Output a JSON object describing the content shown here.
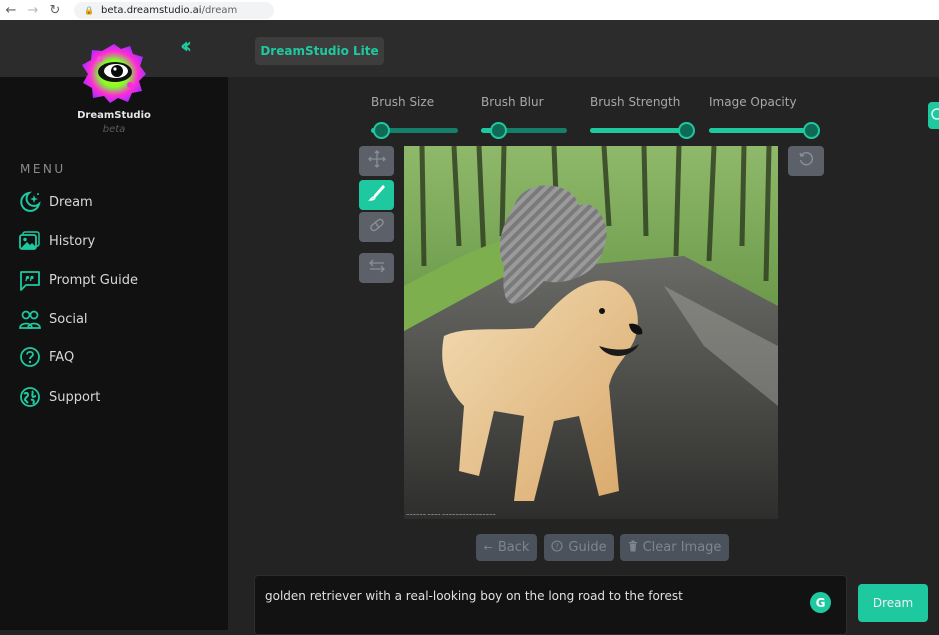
{
  "browser": {
    "back_icon": "arrow-left-icon",
    "forward_icon": "arrow-right-icon",
    "reload_icon": "reload-icon",
    "lock_icon": "lock-icon",
    "url_host": "beta.dreamstudio.ai",
    "url_path": "/dream"
  },
  "header": {
    "collapse_icon": "double-chevron-left-icon",
    "app_badge": "DreamStudio Lite"
  },
  "sidebar": {
    "brand": "DreamStudio",
    "brand_sub": "beta",
    "menu_title": "MENU",
    "items": [
      {
        "label": "Dream",
        "icon": "moon-sparkle-icon"
      },
      {
        "label": "History",
        "icon": "images-icon"
      },
      {
        "label": "Prompt Guide",
        "icon": "quote-bubble-icon"
      },
      {
        "label": "Social",
        "icon": "users-icon"
      },
      {
        "label": "FAQ",
        "icon": "question-circle-icon"
      },
      {
        "label": "Support",
        "icon": "support-globe-icon"
      }
    ]
  },
  "editor": {
    "sliders": [
      {
        "label": "Brush Size",
        "value": 0.12
      },
      {
        "label": "Brush Blur",
        "value": 0.2
      },
      {
        "label": "Brush Strength",
        "value": 1.0
      },
      {
        "label": "Image Opacity",
        "value": 1.0
      }
    ],
    "tools": [
      {
        "name": "move",
        "icon": "move-arrows-icon",
        "active": false
      },
      {
        "name": "brush",
        "icon": "brush-icon",
        "active": true
      },
      {
        "name": "eraser",
        "icon": "eraser-icon",
        "active": false
      },
      {
        "name": "swap",
        "icon": "swap-arrows-icon",
        "active": false
      }
    ],
    "undo_icon": "rotate-ccw-icon",
    "canvas_description": "Golden retriever standing on a forest road, with a striped masked area above its back",
    "canvas_credit": "~~~~~~ ~~~~ ~~~~~~~~~~~~~~~~",
    "actions": {
      "back": "Back",
      "guide": "Guide",
      "clear": "Clear Image"
    }
  },
  "prompt": {
    "value": "golden retriever with a real-looking boy on the long road to the forest",
    "grammar_icon": "G",
    "submit_label": "Dream"
  },
  "colors": {
    "accent": "#1fc9a0",
    "sidebar_bg": "#111111",
    "main_bg": "#232323",
    "topbar_bg": "#2c2c2c",
    "button_muted": "#4b525c"
  }
}
